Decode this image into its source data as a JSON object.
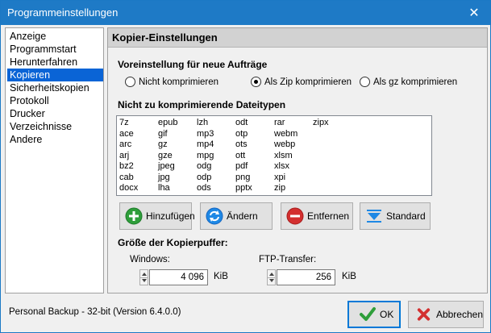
{
  "window": {
    "title": "Programmeinstellungen",
    "close_glyph": "✕"
  },
  "nav": {
    "items": [
      {
        "label": "Anzeige"
      },
      {
        "label": "Programmstart"
      },
      {
        "label": "Herunterfahren"
      },
      {
        "label": "Kopieren",
        "selected": true
      },
      {
        "label": "Sicherheitskopien"
      },
      {
        "label": "Protokoll"
      },
      {
        "label": "Drucker"
      },
      {
        "label": "Verzeichnisse"
      },
      {
        "label": "Andere"
      }
    ]
  },
  "panel": {
    "header": "Kopier-Einstellungen",
    "preset_label": "Voreinstellung für neue Aufträge",
    "compression": {
      "options": [
        "Nicht komprimieren",
        "Als Zip komprimieren",
        "Als gz komprimieren"
      ],
      "selected_index": 1
    },
    "filetypes_label": "Nicht zu komprimierende Dateitypen",
    "filetypes_columns": [
      [
        "7z",
        "ace",
        "arc",
        "arj",
        "bz2",
        "cab",
        "docx"
      ],
      [
        "epub",
        "gif",
        "gz",
        "gze",
        "jpeg",
        "jpg",
        "lha"
      ],
      [
        "lzh",
        "mp3",
        "mp4",
        "mpg",
        "odg",
        "odp",
        "ods"
      ],
      [
        "odt",
        "otp",
        "ots",
        "ott",
        "pdf",
        "png",
        "pptx"
      ],
      [
        "rar",
        "webm",
        "webp",
        "xlsm",
        "xlsx",
        "xpi",
        "zip"
      ],
      [
        "zipx"
      ]
    ],
    "buttons": {
      "add": "Hinzufügen",
      "change": "Ändern",
      "remove": "Entfernen",
      "standard": "Standard"
    },
    "buffer_label": "Größe der Kopierpuffer:",
    "windows_label": "Windows:",
    "windows_value": "4 096",
    "ftp_label": "FTP-Transfer:",
    "ftp_value": "256",
    "unit": "KiB"
  },
  "status": "Personal Backup - 32-bit (Version 6.4.0.0)",
  "dialog": {
    "ok": "OK",
    "cancel": "Abbrechen"
  },
  "colors": {
    "titlebar": "#1e7ac6",
    "selection": "#0a64d6",
    "accent_green": "#2e9e3a",
    "accent_red": "#d32f2f",
    "accent_blue": "#1e88e5"
  }
}
